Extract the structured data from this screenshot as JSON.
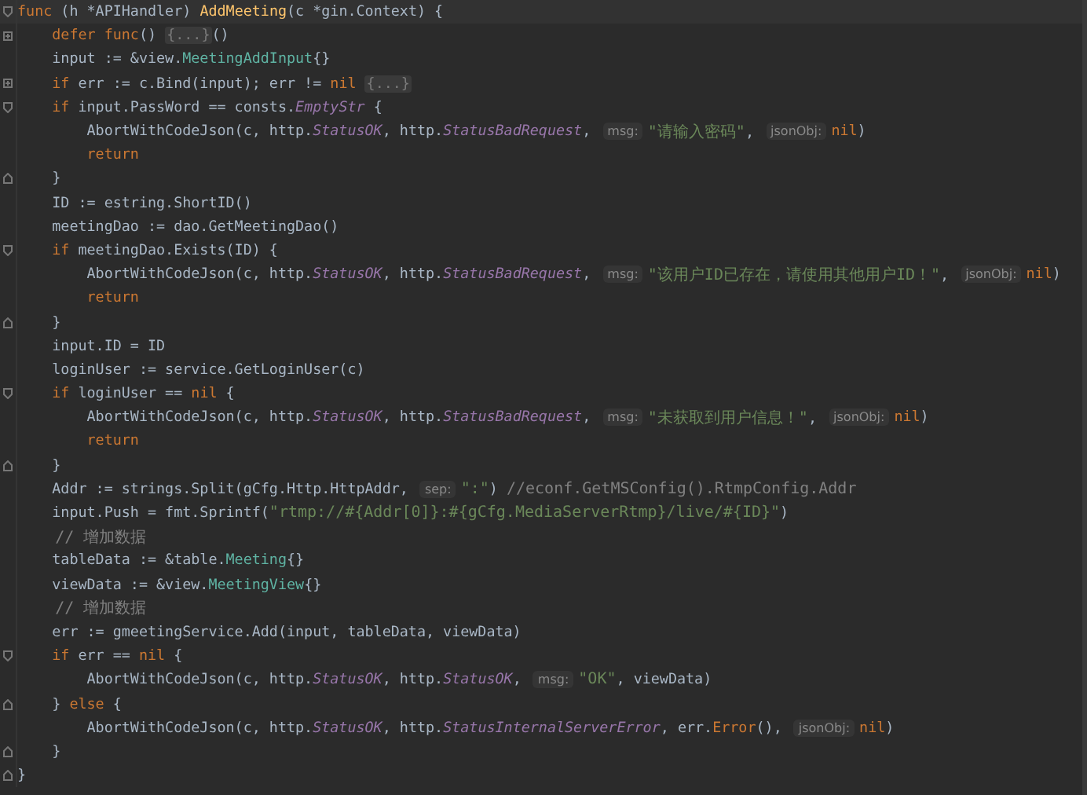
{
  "editor": {
    "lines": [
      {
        "kind": "fold-start",
        "tokens": [
          {
            "kind": "kw",
            "text": "func"
          },
          {
            "kind": "plain",
            "text": " (h *APIHandler) "
          },
          {
            "kind": "fn",
            "text": "AddMeeting"
          },
          {
            "kind": "plain",
            "text": "(c *gin.Context) {"
          }
        ]
      },
      {
        "kind": "folded",
        "tokens": [
          {
            "kind": "kw",
            "text": "    defer func"
          },
          {
            "kind": "plain",
            "text": "() "
          },
          {
            "kind": "fold",
            "text": "{...}"
          },
          {
            "kind": "plain",
            "text": "()"
          }
        ]
      },
      {
        "kind": "code",
        "tokens": [
          {
            "kind": "plain",
            "text": "    input := &view."
          },
          {
            "kind": "type",
            "text": "MeetingAddInput"
          },
          {
            "kind": "plain",
            "text": "{}"
          }
        ]
      },
      {
        "kind": "folded",
        "tokens": [
          {
            "kind": "kw",
            "text": "    if"
          },
          {
            "kind": "plain",
            "text": " err := c.Bind(input); err != "
          },
          {
            "kind": "kw",
            "text": "nil "
          },
          {
            "kind": "fold",
            "text": "{...}"
          }
        ]
      },
      {
        "kind": "fold-start",
        "tokens": [
          {
            "kind": "kw",
            "text": "    if"
          },
          {
            "kind": "plain",
            "text": " input.PassWord == consts."
          },
          {
            "kind": "field",
            "text": "EmptyStr"
          },
          {
            "kind": "plain",
            "text": " {"
          }
        ]
      },
      {
        "kind": "code",
        "tokens": [
          {
            "kind": "plain",
            "text": "        AbortWithCodeJson(c, http."
          },
          {
            "kind": "field",
            "text": "StatusOK"
          },
          {
            "kind": "plain",
            "text": ", http."
          },
          {
            "kind": "field",
            "text": "StatusBadRequest"
          },
          {
            "kind": "plain",
            "text": ", "
          },
          {
            "kind": "hint",
            "text": "msg:"
          },
          {
            "kind": "str",
            "text": "\"请输入密码\""
          },
          {
            "kind": "plain",
            "text": ", "
          },
          {
            "kind": "hint",
            "text": "jsonObj:"
          },
          {
            "kind": "kw",
            "text": "nil"
          },
          {
            "kind": "plain",
            "text": ")"
          }
        ]
      },
      {
        "kind": "code",
        "tokens": [
          {
            "kind": "kw",
            "text": "        return"
          }
        ]
      },
      {
        "kind": "fold-end",
        "tokens": [
          {
            "kind": "plain",
            "text": "    }"
          }
        ]
      },
      {
        "kind": "code",
        "tokens": [
          {
            "kind": "plain",
            "text": "    ID := estring.ShortID()"
          }
        ]
      },
      {
        "kind": "code",
        "tokens": [
          {
            "kind": "plain",
            "text": "    meetingDao := dao.GetMeetingDao()"
          }
        ]
      },
      {
        "kind": "fold-start",
        "tokens": [
          {
            "kind": "kw",
            "text": "    if"
          },
          {
            "kind": "plain",
            "text": " meetingDao.Exists(ID) {"
          }
        ]
      },
      {
        "kind": "code",
        "tokens": [
          {
            "kind": "plain",
            "text": "        AbortWithCodeJson(c, http."
          },
          {
            "kind": "field",
            "text": "StatusOK"
          },
          {
            "kind": "plain",
            "text": ", http."
          },
          {
            "kind": "field",
            "text": "StatusBadRequest"
          },
          {
            "kind": "plain",
            "text": ", "
          },
          {
            "kind": "hint",
            "text": "msg:"
          },
          {
            "kind": "str",
            "text": "\"该用户ID已存在，请使用其他用户ID！\""
          },
          {
            "kind": "plain",
            "text": ", "
          },
          {
            "kind": "hint",
            "text": "jsonObj:"
          },
          {
            "kind": "kw",
            "text": "nil"
          },
          {
            "kind": "plain",
            "text": ")"
          }
        ]
      },
      {
        "kind": "code",
        "tokens": [
          {
            "kind": "kw",
            "text": "        return"
          }
        ]
      },
      {
        "kind": "fold-end",
        "tokens": [
          {
            "kind": "plain",
            "text": "    }"
          }
        ]
      },
      {
        "kind": "code",
        "tokens": [
          {
            "kind": "plain",
            "text": "    input.ID = ID"
          }
        ]
      },
      {
        "kind": "code",
        "tokens": [
          {
            "kind": "plain",
            "text": "    loginUser := service.GetLoginUser(c)"
          }
        ]
      },
      {
        "kind": "fold-start",
        "tokens": [
          {
            "kind": "kw",
            "text": "    if"
          },
          {
            "kind": "plain",
            "text": " loginUser == "
          },
          {
            "kind": "kw",
            "text": "nil"
          },
          {
            "kind": "plain",
            "text": " {"
          }
        ]
      },
      {
        "kind": "code",
        "tokens": [
          {
            "kind": "plain",
            "text": "        AbortWithCodeJson(c, http."
          },
          {
            "kind": "field",
            "text": "StatusOK"
          },
          {
            "kind": "plain",
            "text": ", http."
          },
          {
            "kind": "field",
            "text": "StatusBadRequest"
          },
          {
            "kind": "plain",
            "text": ", "
          },
          {
            "kind": "hint",
            "text": "msg:"
          },
          {
            "kind": "str",
            "text": "\"未获取到用户信息！\""
          },
          {
            "kind": "plain",
            "text": ", "
          },
          {
            "kind": "hint",
            "text": "jsonObj:"
          },
          {
            "kind": "kw",
            "text": "nil"
          },
          {
            "kind": "plain",
            "text": ")"
          }
        ]
      },
      {
        "kind": "code",
        "tokens": [
          {
            "kind": "kw",
            "text": "        return"
          }
        ]
      },
      {
        "kind": "fold-end",
        "tokens": [
          {
            "kind": "plain",
            "text": "    }"
          }
        ]
      },
      {
        "kind": "code",
        "tokens": [
          {
            "kind": "plain",
            "text": "    Addr := strings.Split(gCfg.Http.HttpAddr, "
          },
          {
            "kind": "hint",
            "text": "sep:"
          },
          {
            "kind": "str",
            "text": "\":\""
          },
          {
            "kind": "plain",
            "text": ") "
          },
          {
            "kind": "com",
            "text": "//econf.GetMSConfig().RtmpConfig.Addr"
          }
        ]
      },
      {
        "kind": "code",
        "tokens": [
          {
            "kind": "plain",
            "text": "    input.Push = fmt.Sprintf("
          },
          {
            "kind": "str",
            "text": "\"rtmp://#{Addr[0]}:#{gCfg.MediaServerRtmp}/live/#{ID}\""
          },
          {
            "kind": "plain",
            "text": ")"
          }
        ]
      },
      {
        "kind": "code",
        "tokens": [
          {
            "kind": "com",
            "text": "    // 增加数据"
          }
        ]
      },
      {
        "kind": "code",
        "tokens": [
          {
            "kind": "plain",
            "text": "    tableData := &table."
          },
          {
            "kind": "type",
            "text": "Meeting"
          },
          {
            "kind": "plain",
            "text": "{}"
          }
        ]
      },
      {
        "kind": "code",
        "tokens": [
          {
            "kind": "plain",
            "text": "    viewData := &view."
          },
          {
            "kind": "type",
            "text": "MeetingView"
          },
          {
            "kind": "plain",
            "text": "{}"
          }
        ]
      },
      {
        "kind": "code",
        "tokens": [
          {
            "kind": "com",
            "text": "    // 增加数据"
          }
        ]
      },
      {
        "kind": "code",
        "tokens": [
          {
            "kind": "plain",
            "text": "    err := gmeetingService.Add(input, tableData, viewData)"
          }
        ]
      },
      {
        "kind": "fold-start",
        "tokens": [
          {
            "kind": "kw",
            "text": "    if"
          },
          {
            "kind": "plain",
            "text": " err == "
          },
          {
            "kind": "kw",
            "text": "nil"
          },
          {
            "kind": "plain",
            "text": " {"
          }
        ]
      },
      {
        "kind": "code",
        "tokens": [
          {
            "kind": "plain",
            "text": "        AbortWithCodeJson(c, http."
          },
          {
            "kind": "field",
            "text": "StatusOK"
          },
          {
            "kind": "plain",
            "text": ", http."
          },
          {
            "kind": "field",
            "text": "StatusOK"
          },
          {
            "kind": "plain",
            "text": ", "
          },
          {
            "kind": "hint",
            "text": "msg:"
          },
          {
            "kind": "str",
            "text": "\"OK\""
          },
          {
            "kind": "plain",
            "text": ", viewData)"
          }
        ]
      },
      {
        "kind": "fold-end",
        "tokens": [
          {
            "kind": "plain",
            "text": "    } "
          },
          {
            "kind": "kw",
            "text": "else"
          },
          {
            "kind": "plain",
            "text": " {"
          }
        ]
      },
      {
        "kind": "code",
        "tokens": [
          {
            "kind": "plain",
            "text": "        AbortWithCodeJson(c, http."
          },
          {
            "kind": "field",
            "text": "StatusOK"
          },
          {
            "kind": "plain",
            "text": ", http."
          },
          {
            "kind": "field",
            "text": "StatusInternalServerError"
          },
          {
            "kind": "plain",
            "text": ", err."
          },
          {
            "kind": "kw",
            "text": "Error"
          },
          {
            "kind": "plain",
            "text": "(), "
          },
          {
            "kind": "hint",
            "text": "jsonObj:"
          },
          {
            "kind": "kw",
            "text": "nil"
          },
          {
            "kind": "plain",
            "text": ")"
          }
        ]
      },
      {
        "kind": "fold-end",
        "tokens": [
          {
            "kind": "plain",
            "text": "    }"
          }
        ]
      },
      {
        "kind": "fold-end",
        "tokens": [
          {
            "kind": "plain",
            "text": "}"
          }
        ]
      }
    ]
  }
}
